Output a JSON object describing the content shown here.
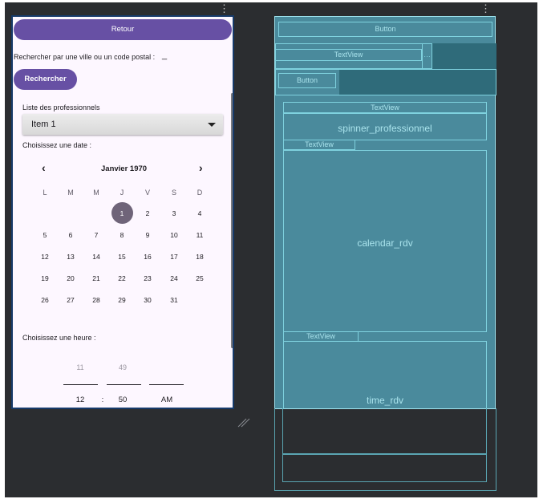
{
  "preview": {
    "back_button": "Retour",
    "search_label": "Rechercher par une ville ou un code postal :",
    "search_input_value": "_",
    "search_button": "Rechercher",
    "professionals_label": "Liste des professionnels",
    "spinner_value": "Item 1",
    "date_label": "Choisissez une date :",
    "calendar": {
      "month_title": "Janvier 1970",
      "prev": "‹",
      "next": "›",
      "weekdays": [
        "L",
        "M",
        "M",
        "J",
        "V",
        "S",
        "D"
      ],
      "weeks": [
        [
          "",
          "",
          "",
          "1",
          "2",
          "3",
          "4"
        ],
        [
          "5",
          "6",
          "7",
          "8",
          "9",
          "10",
          "11"
        ],
        [
          "12",
          "13",
          "14",
          "15",
          "16",
          "17",
          "18"
        ],
        [
          "19",
          "20",
          "21",
          "22",
          "23",
          "24",
          "25"
        ],
        [
          "26",
          "27",
          "28",
          "29",
          "30",
          "31",
          ""
        ]
      ],
      "selected_day": "1"
    },
    "time_label": "Choisissez une heure :",
    "time_picker": {
      "above_hour": "11",
      "above_minute": "49",
      "hour": "12",
      "separator": ":",
      "minute": "50",
      "ampm": "AM"
    }
  },
  "blueprint": {
    "button_top": "Button",
    "textview_search": "TextView",
    "button_search": "Button",
    "textview_list": "TextView",
    "spinner_id": "spinner_professionnel",
    "textview_date": "TextView",
    "calendar_id": "calendar_rdv",
    "textview_time": "TextView",
    "time_id": "time_rdv"
  },
  "colors": {
    "accent": "#6750a4",
    "editor_bg": "#2b2d30",
    "blueprint_bg": "#4a8a9c",
    "blueprint_line": "#7fd2df",
    "selected_day": "#6f6479"
  },
  "icons": {
    "overflow": "vertical-dots-icon",
    "resize": "resize-handle-icon",
    "spinner_arrow": "caret-down-icon"
  }
}
